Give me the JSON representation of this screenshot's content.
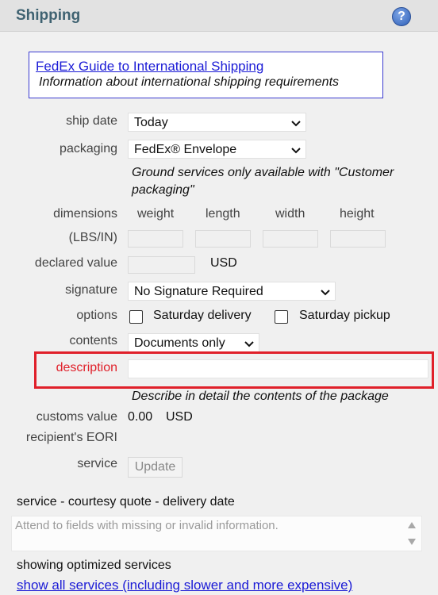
{
  "header": {
    "title": "Shipping",
    "help_icon": "?"
  },
  "guide": {
    "link": "FedEx Guide to International Shipping",
    "info": "Information about international shipping requirements"
  },
  "form": {
    "ship_date": {
      "label": "ship date",
      "value": "Today"
    },
    "packaging": {
      "label": "packaging",
      "value": "FedEx® Envelope"
    },
    "packaging_note": "Ground services only available with \"Customer packaging\"",
    "dimensions": {
      "label": "dimensions",
      "unit_label": "(LBS/IN)",
      "columns": [
        "weight",
        "length",
        "width",
        "height"
      ]
    },
    "declared_value": {
      "label": "declared value",
      "currency": "USD"
    },
    "signature": {
      "label": "signature",
      "value": "No Signature Required"
    },
    "options": {
      "label": "options",
      "saturday_delivery": "Saturday delivery",
      "saturday_pickup": "Saturday pickup"
    },
    "contents": {
      "label": "contents",
      "value": "Documents only"
    },
    "description": {
      "label": "description",
      "note": "Describe in detail the contents of the package"
    },
    "customs_value": {
      "label": "customs value",
      "amount": "0.00",
      "currency": "USD"
    },
    "eori": {
      "label": "recipient's EORI"
    },
    "service": {
      "label": "service",
      "button": "Update"
    }
  },
  "quote": {
    "heading": "service - courtesy quote - delivery date",
    "message": "Attend to fields with missing or invalid information.",
    "showing": "showing optimized services",
    "show_all": "show all services (including slower and more expensive)"
  },
  "colors": {
    "header_title": "#3f6271",
    "link": "#1b1bd6",
    "error": "#e0202a"
  }
}
